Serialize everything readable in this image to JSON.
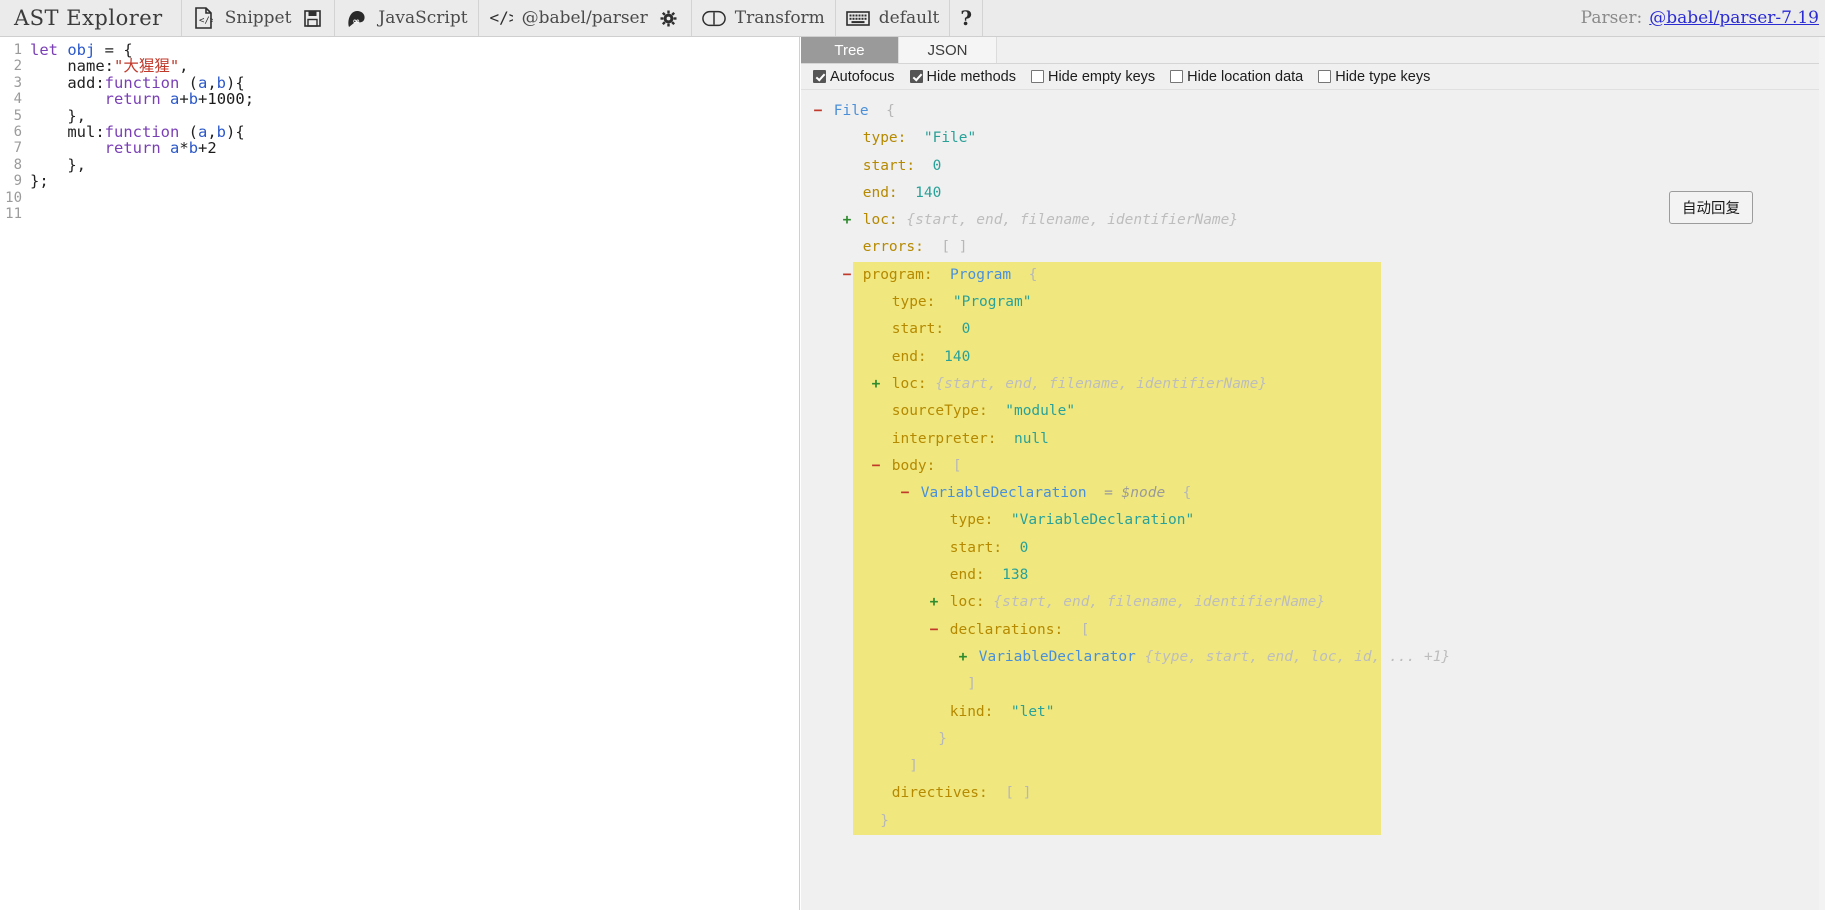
{
  "toolbar": {
    "brand": "AST Explorer",
    "snippet_label": "Snippet",
    "language_label": "JavaScript",
    "parser_label": "@babel/parser",
    "transform_label": "Transform",
    "keymap_label": "default",
    "help_label": "?",
    "parser_info_prefix": "Parser:",
    "parser_info_link": "@babel/parser-7.19",
    "icons": {
      "snippet": "code-file-icon",
      "save": "floppy-save-icon",
      "language": "babel-logo-icon",
      "parser": "code-brackets-icon",
      "settings": "gear-icon",
      "transform": "toggle-switch-icon",
      "keymap": "keyboard-icon",
      "help": "question-mark-icon"
    }
  },
  "editor": {
    "lines": [
      {
        "n": "1",
        "text": "let obj = {"
      },
      {
        "n": "2",
        "text": "    name:\"大猩猩\","
      },
      {
        "n": "3",
        "text": "    add:function (a,b){"
      },
      {
        "n": "4",
        "text": "        return a+b+1000;"
      },
      {
        "n": "5",
        "text": "    },"
      },
      {
        "n": "6",
        "text": "    mul:function (a,b){"
      },
      {
        "n": "7",
        "text": "        return a*b+2"
      },
      {
        "n": "8",
        "text": "    },"
      },
      {
        "n": "9",
        "text": "};"
      },
      {
        "n": "10",
        "text": ""
      },
      {
        "n": "11",
        "text": ""
      }
    ]
  },
  "ast_panel": {
    "tabs": [
      {
        "label": "Tree",
        "active": true
      },
      {
        "label": "JSON",
        "active": false
      }
    ],
    "options": [
      {
        "label": "Autofocus",
        "checked": true
      },
      {
        "label": "Hide methods",
        "checked": true
      },
      {
        "label": "Hide empty keys",
        "checked": false
      },
      {
        "label": "Hide location data",
        "checked": false
      },
      {
        "label": "Hide type keys",
        "checked": false
      }
    ],
    "float_button": "自动回复",
    "tree": [
      {
        "toggle": "-",
        "indent": 0,
        "key": "File",
        "keyType": "node",
        "punc": "{",
        "hl": false
      },
      {
        "toggle": "",
        "indent": 1,
        "key": "type:",
        "value": "\"File\"",
        "valueType": "str",
        "hl": false
      },
      {
        "toggle": "",
        "indent": 1,
        "key": "start:",
        "value": "0",
        "valueType": "num",
        "hl": false
      },
      {
        "toggle": "",
        "indent": 1,
        "key": "end:",
        "value": "140",
        "valueType": "num",
        "hl": false
      },
      {
        "toggle": "+",
        "indent": 1,
        "key": "loc:",
        "ghost": "{start, end, filename, identifierName}",
        "hl": false
      },
      {
        "toggle": "",
        "indent": 1,
        "key": "errors:",
        "punc": "[ ]",
        "hl": false
      },
      {
        "toggle": "-",
        "indent": 1,
        "key": "program:",
        "node": "Program",
        "punc": "{",
        "hl": true
      },
      {
        "toggle": "",
        "indent": 2,
        "key": "type:",
        "value": "\"Program\"",
        "valueType": "str",
        "hl": true
      },
      {
        "toggle": "",
        "indent": 2,
        "key": "start:",
        "value": "0",
        "valueType": "num",
        "hl": true
      },
      {
        "toggle": "",
        "indent": 2,
        "key": "end:",
        "value": "140",
        "valueType": "num",
        "hl": true
      },
      {
        "toggle": "+",
        "indent": 2,
        "key": "loc:",
        "ghost": "{start, end, filename, identifierName}",
        "hl": true
      },
      {
        "toggle": "",
        "indent": 2,
        "key": "sourceType:",
        "value": "\"module\"",
        "valueType": "str",
        "hl": true
      },
      {
        "toggle": "",
        "indent": 2,
        "key": "interpreter:",
        "value": "null",
        "valueType": "null",
        "hl": true
      },
      {
        "toggle": "-",
        "indent": 2,
        "key": "body:",
        "punc": "[",
        "hl": true
      },
      {
        "toggle": "-",
        "indent": 3,
        "node": "VariableDeclaration",
        "annot": "= $node",
        "punc": "{",
        "hl": true
      },
      {
        "toggle": "",
        "indent": 4,
        "key": "type:",
        "value": "\"VariableDeclaration\"",
        "valueType": "str",
        "hl": true
      },
      {
        "toggle": "",
        "indent": 4,
        "key": "start:",
        "value": "0",
        "valueType": "num",
        "hl": true
      },
      {
        "toggle": "",
        "indent": 4,
        "key": "end:",
        "value": "138",
        "valueType": "num",
        "hl": true
      },
      {
        "toggle": "+",
        "indent": 4,
        "key": "loc:",
        "ghost": "{start, end, filename, identifierName}",
        "hl": true
      },
      {
        "toggle": "-",
        "indent": 4,
        "key": "declarations:",
        "punc": "[",
        "hl": true
      },
      {
        "toggle": "+",
        "indent": 5,
        "node": "VariableDeclarator",
        "ghost": "{type, start, end, loc, id, ... +1}",
        "hl": true
      },
      {
        "toggle": "",
        "indent": 4,
        "punc": "]",
        "hl": true
      },
      {
        "toggle": "",
        "indent": 4,
        "key": "kind:",
        "value": "\"let\"",
        "valueType": "str",
        "hl": true
      },
      {
        "toggle": "",
        "indent": 3,
        "punc": "}",
        "hl": true
      },
      {
        "toggle": "",
        "indent": 2,
        "punc": "]",
        "hl": true
      },
      {
        "toggle": "",
        "indent": 2,
        "key": "directives:",
        "punc": "[ ]",
        "hl": true
      },
      {
        "toggle": "",
        "indent": 1,
        "punc": "}",
        "hl": true
      }
    ]
  },
  "colors": {
    "toolbar_bg": "#ebebeb",
    "ast_bg": "#f0f0f0",
    "highlight": "#f0e87f",
    "tab_active_bg": "#9a9a9a",
    "link": "#2b2bd4",
    "tree_key": "#b58900",
    "tree_node": "#4a90d9",
    "tree_value": "#2aa198"
  }
}
